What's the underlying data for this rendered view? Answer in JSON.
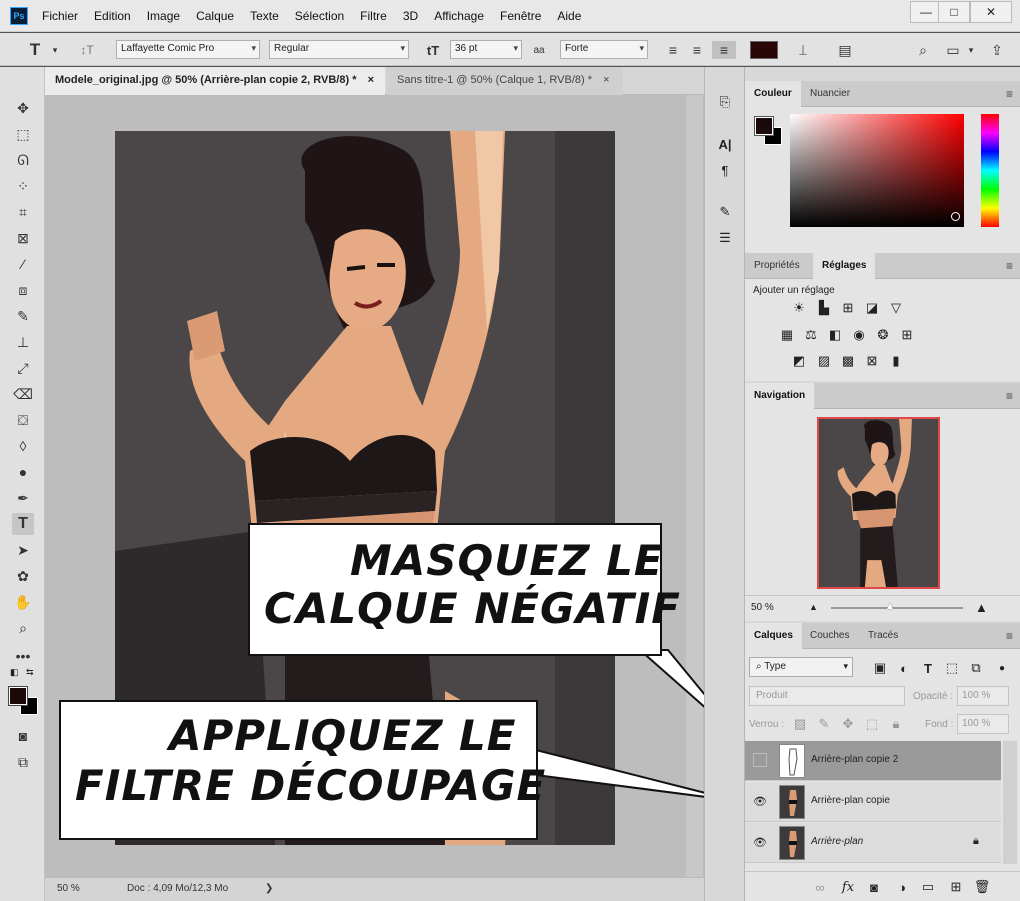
{
  "app": {
    "logo": "Ps"
  },
  "menu": [
    "Fichier",
    "Edition",
    "Image",
    "Calque",
    "Texte",
    "Sélection",
    "Filtre",
    "3D",
    "Affichage",
    "Fenêtre",
    "Aide"
  ],
  "window_controls": {
    "minimize": "—",
    "maximize": "□",
    "close": "✕"
  },
  "options": {
    "tool_glyph": "T",
    "font_family": "Laffayette Comic Pro",
    "font_style": "Regular",
    "font_size": "36 pt",
    "antialias_icon": "aa",
    "antialias": "Forte",
    "text_color": "#2a0707"
  },
  "tabs": [
    {
      "label": "Modele_original.jpg @ 50% (Arrière-plan copie 2, RVB/8) *",
      "close": "×"
    },
    {
      "label": "Sans titre-1 @ 50% (Calque 1, RVB/8) *",
      "close": "×"
    }
  ],
  "status": {
    "zoom": "50 %",
    "doc": "Doc : 4,09 Mo/12,3 Mo",
    "arrow": "❯"
  },
  "callouts": {
    "top": {
      "line1": "MASQUEZ LE",
      "line2": "CALQUE NÉGATIF"
    },
    "bottom": {
      "line1": "APPLIQUEZ LE",
      "line2": "FILTRE DÉCOUPAGE"
    }
  },
  "panels": {
    "color": {
      "tabs": [
        "Couleur",
        "Nuancier"
      ],
      "fg": "#1a0a0a",
      "bg": "#000000",
      "hue": "#ff0000"
    },
    "properties": {
      "tabs": [
        "Propriétés",
        "Réglages"
      ],
      "add_label": "Ajouter un réglage"
    },
    "navigation": {
      "tab": "Navigation",
      "zoom": "50 %"
    },
    "layers": {
      "tabs": [
        "Calques",
        "Couches",
        "Tracés"
      ],
      "filter": "Type",
      "blend": "Produit",
      "opacity_label": "Opacité :",
      "opacity": "100 %",
      "lock_label": "Verrou :",
      "fill_label": "Fond :",
      "fill": "100 %",
      "items": [
        {
          "name": "Arrière-plan copie 2",
          "visible": false
        },
        {
          "name": "Arrière-plan copie",
          "visible": true
        },
        {
          "name": "Arrière-plan",
          "visible": true
        }
      ]
    }
  }
}
